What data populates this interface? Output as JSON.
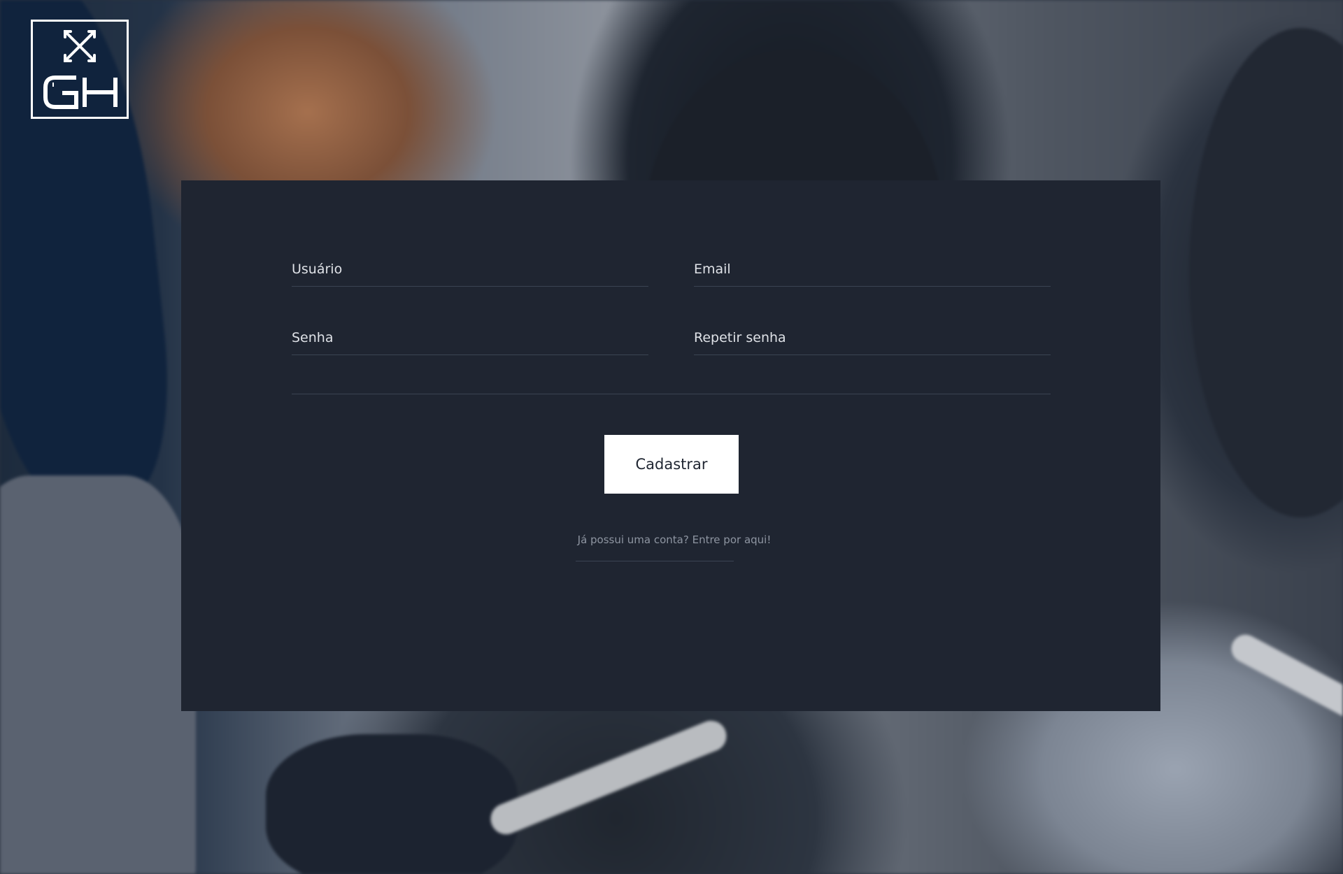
{
  "brand": {
    "logo_text": "GH"
  },
  "form": {
    "username_placeholder": "Usuário",
    "email_placeholder": "Email",
    "password_placeholder": "Senha",
    "repeat_password_placeholder": "Repetir senha",
    "submit_label": "Cadastrar",
    "login_link_text": "Já possui uma conta? Entre por aqui!"
  },
  "colors": {
    "panel_background": "#1f2531",
    "button_background": "#ffffff",
    "button_text": "#1f2531",
    "field_text": "#e8eaed",
    "muted_text": "#8e95a1"
  },
  "icons": {
    "logo": "crossed-arrows-monogram-icon"
  }
}
